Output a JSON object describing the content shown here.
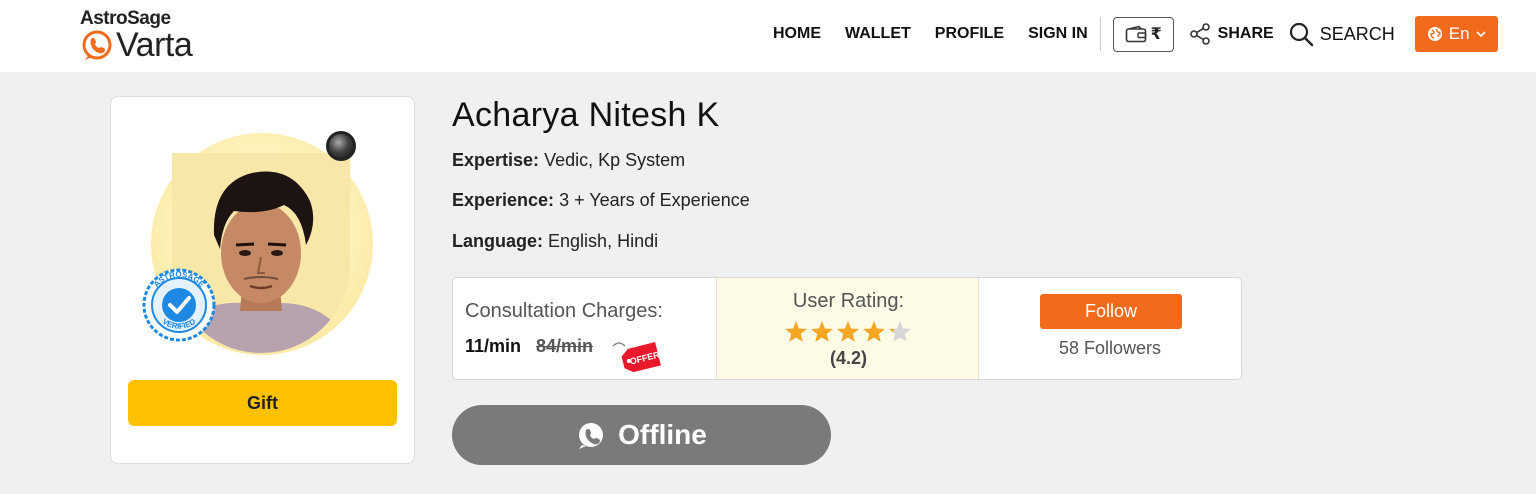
{
  "brand": {
    "logo_top": "AstroSage",
    "logo_bottom": "Varta"
  },
  "nav": {
    "home": "HOME",
    "wallet": "WALLET",
    "profile": "PROFILE",
    "sign_in": "SIGN IN",
    "wallet_currency": "₹",
    "share": "SHARE",
    "search": "SEARCH",
    "language": "En"
  },
  "profile": {
    "name": "Acharya Nitesh K",
    "expertise_label": "Expertise:",
    "expertise": "Vedic, Kp System",
    "experience_label": "Experience:",
    "experience": "3 + Years of Experience",
    "language_label": "Language:",
    "language": "English, Hindi",
    "gift_label": "Gift",
    "badge_text_top": "ASTROSAGE",
    "badge_text_bottom": "VERIFIED",
    "status": "offline"
  },
  "stats": {
    "charges_label": "Consultation Charges:",
    "price": "11/min",
    "old_price": "84/min",
    "offer_tag": "OFFER",
    "rating_label": "User Rating:",
    "rating": 4.2,
    "rating_text": "(4.2)",
    "follow_label": "Follow",
    "followers": "58 Followers"
  },
  "action": {
    "offline_label": "Offline"
  },
  "colors": {
    "accent_orange": "#f26b1d",
    "gift_yellow": "#fdc100",
    "offline_gray": "#7a7a7a",
    "star_gold": "#f5a623",
    "badge_blue": "#1e88e5"
  }
}
